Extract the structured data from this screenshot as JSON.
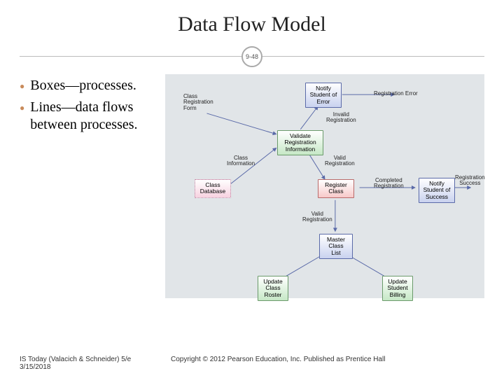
{
  "title": "Data Flow Model",
  "slide_number": "9-48",
  "bullets": [
    "Boxes—processes.",
    "Lines—data flows between processes."
  ],
  "diagram": {
    "boxes": {
      "notify_error": {
        "text": "Notify\nStudent of\nError"
      },
      "validate": {
        "text": "Validate\nRegistration\nInformation"
      },
      "class_db": {
        "text": "Class\nDatabase"
      },
      "register": {
        "text": "Register\nClass"
      },
      "notify_success": {
        "text": "Notify\nStudent of\nSuccess"
      },
      "master_list": {
        "text": "Master\nClass\nList"
      },
      "update_roster": {
        "text": "Update\nClass\nRoster"
      },
      "update_billing": {
        "text": "Update\nStudent\nBilling"
      }
    },
    "labels": {
      "reg_error": "Registration Error",
      "class_form": "Class\nRegistration\nForm",
      "invalid_reg": "Invalid\nRegistration",
      "class_info": "Class\nInformation",
      "valid_reg1": "Valid\nRegistration",
      "completed_reg": "Completed\nRegistration",
      "reg_success": "Registration\nSuccess",
      "valid_reg2": "Valid\nRegistration"
    }
  },
  "footer": {
    "book": "IS Today (Valacich & Schneider) 5/e",
    "date": "3/15/2018",
    "copyright": "Copyright © 2012 Pearson Education, Inc. Published as Prentice Hall"
  }
}
